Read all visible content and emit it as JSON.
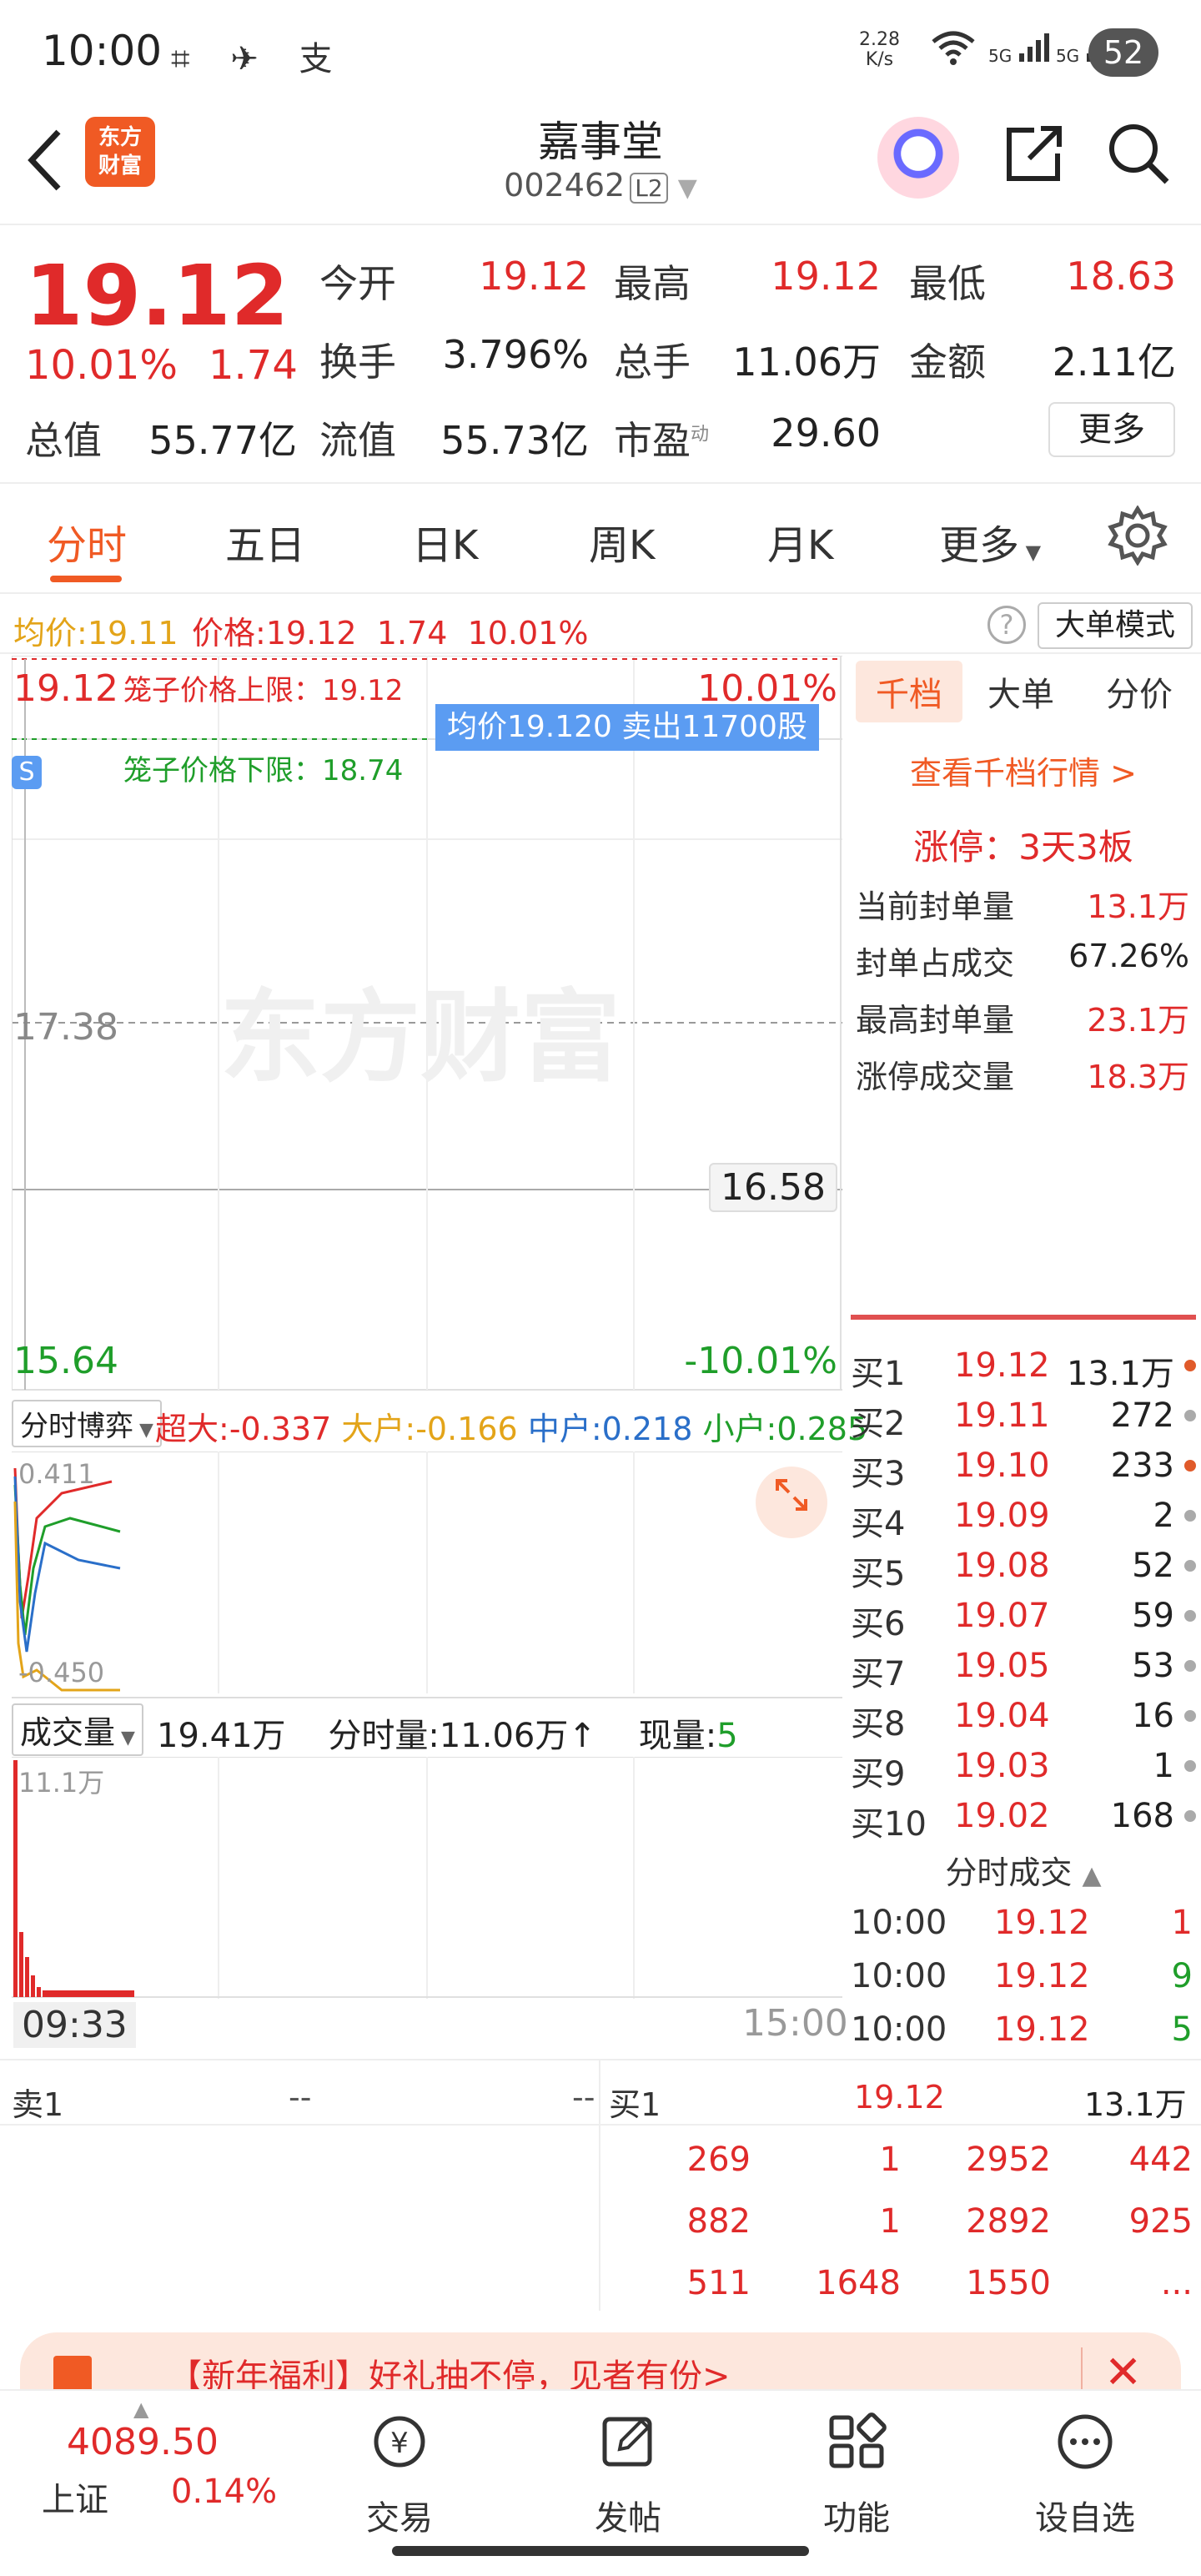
{
  "status_bar": {
    "time": "10:00",
    "icons": "⌗ ✈ 支",
    "speed_value": "2.28",
    "speed_unit": "K/s",
    "wifi_icon": "wifi-icon",
    "net1": "5G",
    "net2": "5G",
    "battery": "52"
  },
  "header": {
    "logo_line1": "东方",
    "logo_line2": "财富",
    "stock_name": "嘉事堂",
    "stock_code": "002462",
    "level_badge": "L2"
  },
  "quote": {
    "price": "19.12",
    "change_pct": "10.01%",
    "change_amt": "1.74",
    "rows": [
      [
        {
          "label": "今开",
          "value": "19.12",
          "color": "red"
        },
        {
          "label": "最高",
          "value": "19.12",
          "color": "red"
        },
        {
          "label": "最低",
          "value": "18.63",
          "color": "red"
        }
      ],
      [
        {
          "label": "换手",
          "value": "3.796%",
          "color": "black"
        },
        {
          "label": "总手",
          "value": "11.06万",
          "color": "black"
        },
        {
          "label": "金额",
          "value": "2.11亿",
          "color": "black"
        }
      ],
      [
        {
          "label": "总值",
          "value": "55.77亿",
          "color": "black"
        },
        {
          "label": "流值",
          "value": "55.73亿",
          "color": "black"
        },
        {
          "label": "市盈",
          "value": "29.60",
          "color": "black"
        }
      ]
    ],
    "pe_sup": "动",
    "more_label": "更多"
  },
  "tabs": [
    "分时",
    "五日",
    "日K",
    "周K",
    "月K",
    "更多"
  ],
  "avg_bar": {
    "avg_label": "均价:",
    "avg_value": "19.11",
    "price_label": "价格:",
    "price_value": "19.12",
    "chg": "1.74",
    "pct": "10.01%",
    "help": "?",
    "mode": "大单模式"
  },
  "chart": {
    "price_top": "19.12",
    "price_mid": "17.38",
    "price_bottom": "15.64",
    "pct_top": "10.01%",
    "pct_bottom": "-10.01%",
    "prev_close": "16.58",
    "cage_up": "笼子价格上限：19.12",
    "cage_down": "笼子价格下限：18.74",
    "avg_tip": "均价19.120  卖出11700股",
    "watermark": "东方财富",
    "s_badge": "S"
  },
  "chart_data": {
    "type": "line",
    "ylim": [
      15.64,
      19.12
    ],
    "prev_close": 16.58,
    "x": [
      "09:33",
      "15:00"
    ]
  },
  "game": {
    "selector": "分时博弈",
    "items": [
      {
        "label": "超大:",
        "value": "-0.337",
        "color": "#e02a2a"
      },
      {
        "label": "大户:",
        "value": "-0.166",
        "color": "#e3a419"
      },
      {
        "label": "中户:",
        "value": "0.218",
        "color": "#2a6fc9"
      },
      {
        "label": "小户:",
        "value": "0.285",
        "color": "#1f9e2a"
      }
    ],
    "top_val": "0.411",
    "bot_val": "-0.450"
  },
  "volume": {
    "selector": "成交量",
    "total": "19.41万",
    "fs_label": "分时量:",
    "fs_value": "11.06万",
    "arrow": "↑",
    "now_label": "现量:",
    "now_value": "5",
    "axis_top": "11.1万",
    "time_start": "09:33",
    "time_end": "15:00"
  },
  "rpanel": {
    "tabs": [
      "千档",
      "大单",
      "分价"
    ],
    "link": "查看千档行情 >",
    "limit_up": "涨停：3天3板",
    "stats": [
      {
        "label": "当前封单量",
        "value": "13.1万",
        "color": "red"
      },
      {
        "label": "封单占成交",
        "value": "67.26%",
        "color": "black"
      },
      {
        "label": "最高封单量",
        "value": "23.1万",
        "color": "red"
      },
      {
        "label": "涨停成交量",
        "value": "18.3万",
        "color": "red"
      }
    ],
    "bids": [
      {
        "label": "买1",
        "price": "19.12",
        "vol": "13.1万",
        "dot": "red"
      },
      {
        "label": "买2",
        "price": "19.11",
        "vol": "272",
        "dot": "gray"
      },
      {
        "label": "买3",
        "price": "19.10",
        "vol": "233",
        "dot": "red"
      },
      {
        "label": "买4",
        "price": "19.09",
        "vol": "2",
        "dot": "gray"
      },
      {
        "label": "买5",
        "price": "19.08",
        "vol": "52",
        "dot": "gray"
      },
      {
        "label": "买6",
        "price": "19.07",
        "vol": "59",
        "dot": "gray"
      },
      {
        "label": "买7",
        "price": "19.05",
        "vol": "53",
        "dot": "gray"
      },
      {
        "label": "买8",
        "price": "19.04",
        "vol": "16",
        "dot": "gray"
      },
      {
        "label": "买9",
        "price": "19.03",
        "vol": "1",
        "dot": "gray"
      },
      {
        "label": "买10",
        "price": "19.02",
        "vol": "168",
        "dot": "gray"
      }
    ],
    "fs_title": "分时成交",
    "fs_arrow": "▲",
    "trades": [
      {
        "time": "10:00",
        "price": "19.12",
        "vol": "1",
        "color": "red"
      },
      {
        "time": "10:00",
        "price": "19.12",
        "vol": "9",
        "color": "green"
      },
      {
        "time": "10:00",
        "price": "19.12",
        "vol": "5",
        "color": "green"
      }
    ]
  },
  "bottom_table": {
    "sell_label": "卖1",
    "sell_v1": "--",
    "sell_v2": "--",
    "buy_label": "买1",
    "buy_price": "19.12",
    "buy_vol": "13.1万",
    "rows": [
      [
        "269",
        "1",
        "2952",
        "442"
      ],
      [
        "882",
        "1",
        "2892",
        "925"
      ],
      [
        "511",
        "1648",
        "1550",
        "..."
      ]
    ]
  },
  "banner": {
    "text": "【新年福利】好礼抽不停，见者有份>",
    "close": "✕"
  },
  "bottom_nav": {
    "index_value": "4089.50",
    "index_name": "上证",
    "index_pct": "0.14%",
    "items": [
      {
        "label": "交易",
        "icon": "¥"
      },
      {
        "label": "发帖",
        "icon": "✎"
      },
      {
        "label": "功能",
        "icon": "▦"
      },
      {
        "label": "设自选",
        "icon": "⋯"
      }
    ]
  }
}
